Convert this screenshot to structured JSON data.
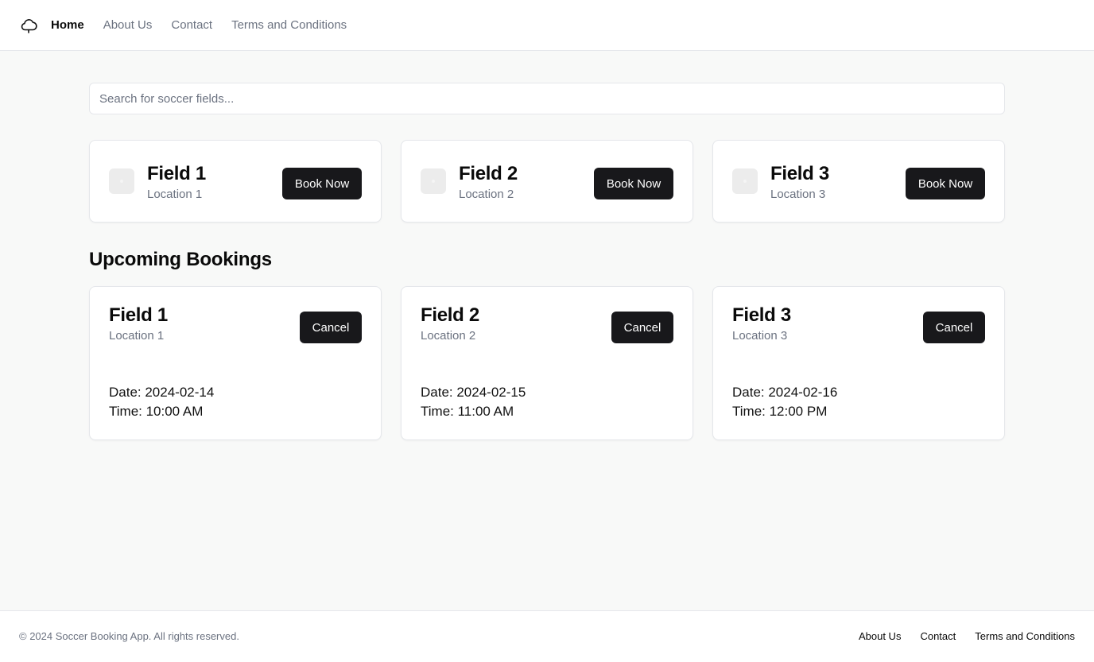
{
  "nav": {
    "logo_icon": "cloud-outline-icon",
    "items": [
      {
        "label": "Home",
        "active": true
      },
      {
        "label": "About Us",
        "active": false
      },
      {
        "label": "Contact",
        "active": false
      },
      {
        "label": "Terms and Conditions",
        "active": false
      }
    ]
  },
  "search": {
    "placeholder": "Search for soccer fields...",
    "value": ""
  },
  "fields": [
    {
      "name": "Field 1",
      "location": "Location 1",
      "button": "Book Now"
    },
    {
      "name": "Field 2",
      "location": "Location 2",
      "button": "Book Now"
    },
    {
      "name": "Field 3",
      "location": "Location 3",
      "button": "Book Now"
    }
  ],
  "bookings_section": {
    "title": "Upcoming Bookings",
    "items": [
      {
        "name": "Field 1",
        "location": "Location 1",
        "date": "Date: 2024-02-14",
        "time": "Time: 10:00 AM",
        "button": "Cancel"
      },
      {
        "name": "Field 2",
        "location": "Location 2",
        "date": "Date: 2024-02-15",
        "time": "Time: 11:00 AM",
        "button": "Cancel"
      },
      {
        "name": "Field 3",
        "location": "Location 3",
        "date": "Date: 2024-02-16",
        "time": "Time: 12:00 PM",
        "button": "Cancel"
      }
    ]
  },
  "footer": {
    "copyright": "© 2024 Soccer Booking App. All rights reserved.",
    "links": [
      "About Us",
      "Contact",
      "Terms and Conditions"
    ]
  },
  "colors": {
    "background": "#f8f9f8",
    "surface": "#ffffff",
    "border": "#e5e7eb",
    "primary_button": "#18181b",
    "muted_text": "#6b7280"
  }
}
